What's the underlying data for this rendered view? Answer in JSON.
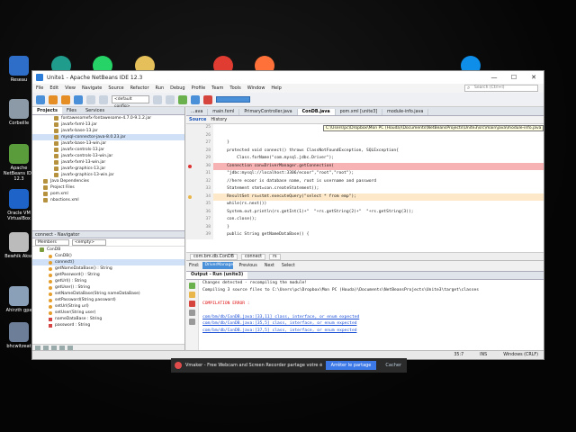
{
  "desktop": {
    "icons": [
      {
        "label": "Reseau",
        "color": "#2e6ec9"
      },
      {
        "label": "Corbeille",
        "color": "#8c9aa8"
      },
      {
        "label": "Apache NetBeans IDE 12.3",
        "color": "#5a9c3c"
      },
      {
        "label": "Oracle VM VirtualBox",
        "color": "#1e64c8"
      },
      {
        "label": "Bewhik Akso",
        "color": "#bbbbbb"
      },
      {
        "label": "Ahirzth gpx",
        "color": "#8aa0b8"
      },
      {
        "label": "bhcwitzeat",
        "color": "#6d7e99"
      }
    ],
    "top_icons": [
      {
        "name": "edge-icon",
        "color": "#1f9c8b"
      },
      {
        "name": "whatsapp-icon",
        "color": "#25d366"
      },
      {
        "name": "folder-icon",
        "color": "#e5c05a"
      },
      {
        "name": "opera-icon",
        "color": "#e03c31"
      },
      {
        "name": "firefox-icon",
        "color": "#ff7139"
      },
      {
        "name": "teamviewer-icon",
        "color": "#0e8ee9"
      }
    ]
  },
  "window": {
    "title": "Unite1 - Apache NetBeans IDE 12.3",
    "menu": [
      "File",
      "Edit",
      "View",
      "Navigate",
      "Source",
      "Refactor",
      "Run",
      "Debug",
      "Profile",
      "Team",
      "Tools",
      "Window",
      "Help"
    ],
    "search_placeholder": "Search (Ctrl+I)",
    "config_select": "<default config>"
  },
  "projects_pane": {
    "tabs": [
      "Projects",
      "Files",
      "Services"
    ],
    "items": [
      "fontawesomefx-fontawesome-4.7.0-9.1.2.jar",
      "javafx-fxml-13.jar",
      "javafx-base-13.jar",
      "mysql-connector-java-8.0.23.jar",
      "javafx-base-13-win.jar",
      "javafx-controls-13.jar",
      "javafx-controls-13-win.jar",
      "javafx-fxml-13-win.jar",
      "javafx-graphics-13.jar",
      "javafx-graphics-13-win.jar",
      "Java Dependencies",
      "Project Files",
      "pom.xml",
      "nbactions.xml"
    ]
  },
  "navigator": {
    "title": "connect - Navigator",
    "members_label": "Members",
    "empty_select": "<empty>",
    "items": [
      {
        "kind": "c",
        "text": "ConDB"
      },
      {
        "kind": "m",
        "text": "ConDB()"
      },
      {
        "kind": "m",
        "text": "connect()"
      },
      {
        "kind": "m",
        "text": "getNameDataBase() : String"
      },
      {
        "kind": "m",
        "text": "getPassword() : String"
      },
      {
        "kind": "m",
        "text": "getUrl() : String"
      },
      {
        "kind": "m",
        "text": "getUser() : String"
      },
      {
        "kind": "m",
        "text": "setNameDataBase(String nameDataBase)"
      },
      {
        "kind": "m",
        "text": "setPassword(String password)"
      },
      {
        "kind": "m",
        "text": "setUrl(String url)"
      },
      {
        "kind": "m",
        "text": "setUser(String user)"
      },
      {
        "kind": "f",
        "text": "nameDataBase : String"
      },
      {
        "kind": "f",
        "text": "password : String"
      }
    ]
  },
  "editor": {
    "tabs": [
      "...ava",
      "main.fxml",
      "PrimaryController.java",
      "ConDB.java",
      "pom.xml [unite3]",
      "module-info.java"
    ],
    "toolbar": [
      "Source",
      "History"
    ],
    "tooltip": "C:\\Users\\pc\\Dropbox\\Mon PC (Houda)\\Documents\\NetBeansProjects\\Unite3\\src\\main\\java\\module-info.java",
    "lines": [
      {
        "n": "25",
        "t": ""
      },
      {
        "n": "26",
        "t": ""
      },
      {
        "n": "27",
        "t": "    }"
      },
      {
        "n": "28",
        "t": "    protected void connect() throws ClassNotFoundException, SQLException{"
      },
      {
        "n": "29",
        "t": "        Class.forName(\"com.mysql.jdbc.Driver\");"
      },
      {
        "n": "30",
        "t": "    Connection con=DriverManager.getConnection(",
        "state": "err"
      },
      {
        "n": "31",
        "t": "    \"jdbc:mysql://localhost:3306/ecoor\",\"root\",\"root\");"
      },
      {
        "n": "32",
        "t": "    //here ecoor is database name, root is username and password"
      },
      {
        "n": "33",
        "t": "    Statement stmt=con.createStatement();"
      },
      {
        "n": "34",
        "t": "    ResultSet rs=stmt.executeQuery(\"select * from emp\");",
        "state": "warn"
      },
      {
        "n": "35",
        "t": "    while(rs.next())"
      },
      {
        "n": "36",
        "t": "    System.out.println(rs.getInt(1)+\"  \"+rs.getString(2)+\"  \"+rs.getString(3));"
      },
      {
        "n": "37",
        "t": "    con.close();"
      },
      {
        "n": "38",
        "t": "    }"
      },
      {
        "n": "39",
        "t": "    public String getNameDataBase() {"
      }
    ],
    "breadcrumb": [
      "com.bm.db.ConDB",
      "connect",
      "rs"
    ]
  },
  "findbar": {
    "label": "Find:",
    "value": "DriverManager",
    "buttons": [
      "Previous",
      "Next",
      "Select"
    ]
  },
  "output": {
    "tabs": [
      "Output - Run (unite3)"
    ],
    "lines": [
      {
        "t": "Changes detected - recompiling the module!",
        "cls": ""
      },
      {
        "t": "Compiling 3 source files to C:\\Users\\pc\\Dropbox\\Mon PC (Houda)\\Documents\\NetBeansProjects\\Unite3\\target\\classes",
        "cls": ""
      },
      {
        "t": "",
        "cls": ""
      },
      {
        "t": "COMPILATION ERROR :",
        "cls": "red"
      },
      {
        "t": "",
        "cls": ""
      },
      {
        "t": "com/bm/db/ConDB.java:[33,11] class, interface, or enum expected",
        "cls": "link"
      },
      {
        "t": "com/bm/db/ConDB.java:[35,5] class, interface, or enum expected",
        "cls": "link"
      },
      {
        "t": "com/bm/db/ConDB.java:[37,5] class, interface, or enum expected",
        "cls": "link"
      }
    ]
  },
  "status": {
    "position": "35:7",
    "mode": "INS",
    "line_ending": "Windows (CRLF)"
  },
  "notification": {
    "text": "Vmaker - Free Webcam and Screen Recorder partage votre écran",
    "stop_label": "Arrêter le partage",
    "hide_label": "Cacher"
  }
}
